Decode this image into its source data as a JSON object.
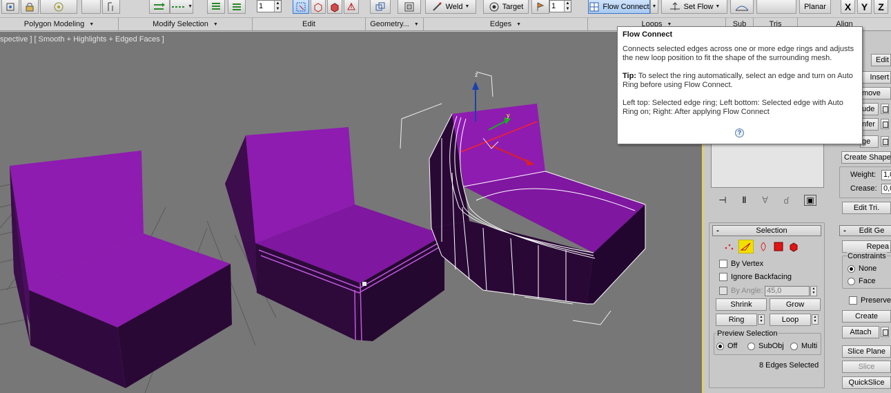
{
  "ribbon": {
    "weld_label": "Weld",
    "target_label": "Target",
    "flow_connect_label": "Flow Connect",
    "set_flow_label": "Set Flow",
    "planar_label": "Planar",
    "spinner_a": "1",
    "spinner_b": "1",
    "x_label": "X",
    "y_label": "Y",
    "z_label": "Z",
    "groups": {
      "polygon_modeling": "Polygon Modeling",
      "modify_selection": "Modify Selection",
      "edit": "Edit",
      "geometry": "Geometry...",
      "edges": "Edges",
      "loops": "Loops",
      "sub": "Sub",
      "tris": "Tris",
      "align": "Align"
    }
  },
  "viewport": {
    "label": "spective ] [ Smooth + Highlights + Edged Faces ]",
    "gizmo_z": "z",
    "gizmo_y": "y",
    "mesh_color": "#8e1cb0",
    "background": "#777777"
  },
  "tooltip": {
    "title": "Flow Connect",
    "body": "Connects selected edges across one or more edge rings and adjusts the new loop position to fit the shape of the surrounding mesh.",
    "tip_label": "Tip:",
    "tip_text": "To select the ring automatically, select an edge and turn on Auto Ring before using Flow Connect.",
    "caption": "Left top: Selected edge ring; Left bottom: Selected edge with Auto Ring on; Right: After applying Flow Connect",
    "help_glyph": "?"
  },
  "panel": {
    "edit_label": "Edit",
    "insert_label": "Insert",
    "remove_label": "move",
    "extrude_label": "ude",
    "chamfer_label": "nfer",
    "bridge_label": "ge",
    "create_shape_label": "Create Shape",
    "weight_label": "Weight:",
    "weight_value": "1,0",
    "crease_label": "Crease:",
    "crease_value": "0,0",
    "edit_tri_label": "Edit Tri.",
    "selection_title": "Selection",
    "edit_geometry_title": "Edit Ge",
    "by_vertex_label": "By Vertex",
    "ignore_backfacing_label": "Ignore Backfacing",
    "by_angle_label": "By Angle:",
    "by_angle_value": "45,0",
    "shrink_label": "Shrink",
    "grow_label": "Grow",
    "ring_label": "Ring",
    "loop_label": "Loop",
    "preview_selection_label": "Preview Selection",
    "off_label": "Off",
    "subobj_label": "SubObj",
    "multi_label": "Multi",
    "edges_selected": "8 Edges Selected",
    "repeat_label": "Repea",
    "constraints_label": "Constraints",
    "none_label": "None",
    "face_label": "Face",
    "preserve_label": "Preserve",
    "create_label": "Create",
    "attach_label": "Attach",
    "slice_plane_label": "Slice Plane",
    "slice_label": "Slice",
    "quickslice_label": "QuickSlice",
    "active_border_color": "#e8d44a"
  }
}
